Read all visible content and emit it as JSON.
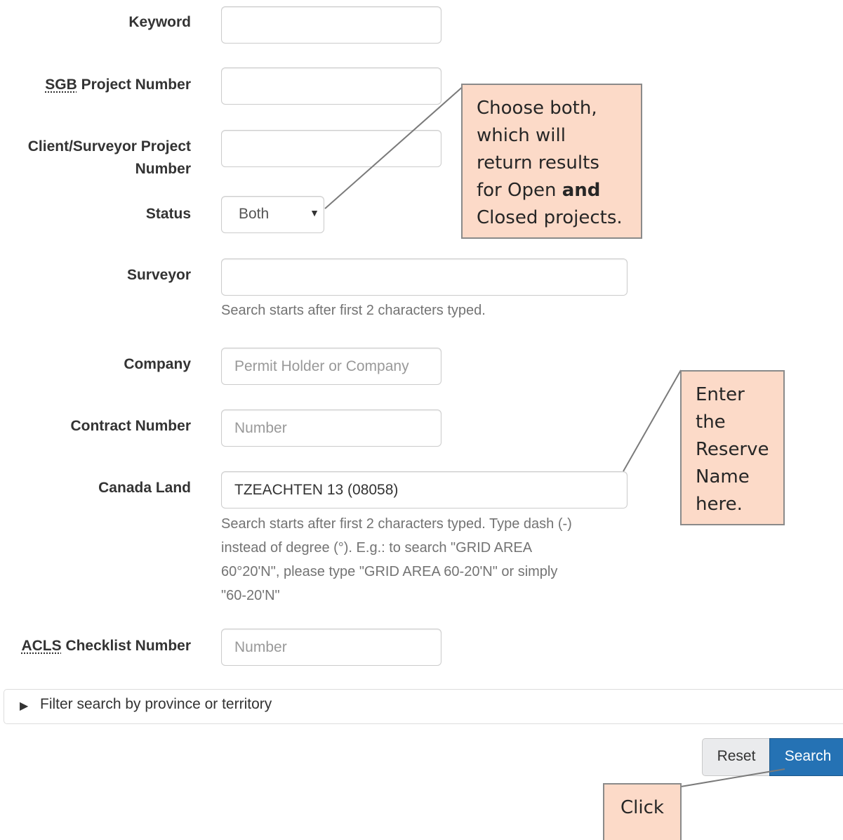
{
  "form": {
    "keyword": {
      "label": "Keyword",
      "value": ""
    },
    "sgb_project_number": {
      "label_abbr": "SGB",
      "label_rest": " Project Number",
      "value": ""
    },
    "client_project_number": {
      "label_line1": "Client/Surveyor Project",
      "label_line2": "Number",
      "value": ""
    },
    "status": {
      "label": "Status",
      "selected": "Both"
    },
    "surveyor": {
      "label": "Surveyor",
      "value": "",
      "help": "Search starts after first 2 characters typed."
    },
    "company": {
      "label": "Company",
      "placeholder": "Permit Holder or Company"
    },
    "contract_number": {
      "label": "Contract Number",
      "placeholder": "Number"
    },
    "canada_land": {
      "label": "Canada Land",
      "value": "TZEACHTEN 13 (08058)",
      "help_line1": "Search starts after first 2 characters typed. Type dash (-)",
      "help_line2": "instead of degree (°). E.g.: to search \"GRID AREA",
      "help_line3": "60°20'N\", please type \"GRID AREA 60-20'N\" or simply",
      "help_line4": "\"60-20'N\""
    },
    "acls_checklist_number": {
      "label_abbr": "ACLS",
      "label_rest": " Checklist Number",
      "placeholder": "Number"
    }
  },
  "filter": {
    "label": "Filter search by province or territory"
  },
  "buttons": {
    "reset": "Reset",
    "search": "Search"
  },
  "callouts": {
    "status": {
      "line1": "Choose both,",
      "line2": "which will",
      "line3": "return results",
      "line4_pre": "for Open ",
      "line4_bold": "and",
      "line5": "Closed projects."
    },
    "canada_land": {
      "line1": "Enter",
      "line2": "the",
      "line3": "Reserve",
      "line4": "Name",
      "line5": "here."
    },
    "search": {
      "line1": "Click"
    }
  },
  "colors": {
    "callout_bg": "#fcdac8",
    "search_button": "#2572b4",
    "label_text": "#333333",
    "help_text": "#737373"
  }
}
